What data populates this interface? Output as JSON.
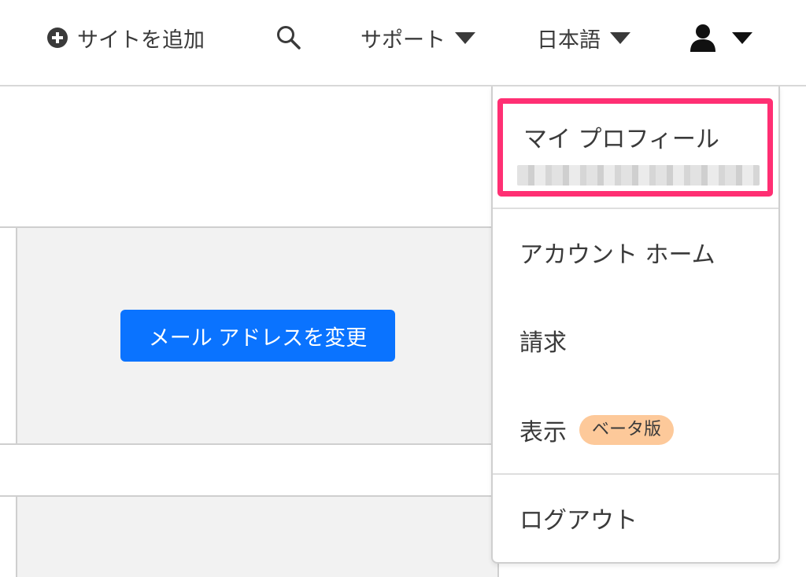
{
  "topbar": {
    "add_site_label": "サイトを追加",
    "support_label": "サポート",
    "language_label": "日本語"
  },
  "main": {
    "change_email_label": "メール アドレスを変更"
  },
  "user_menu": {
    "profile_label": "マイ プロフィール",
    "account_home_label": "アカウント ホーム",
    "billing_label": "請求",
    "appearance_label": "表示",
    "beta_badge": "ベータ版",
    "logout_label": "ログアウト"
  },
  "colors": {
    "primary_button": "#0a73ff",
    "highlight_border": "#ff2f73",
    "beta_badge_bg": "#fdc99a"
  }
}
